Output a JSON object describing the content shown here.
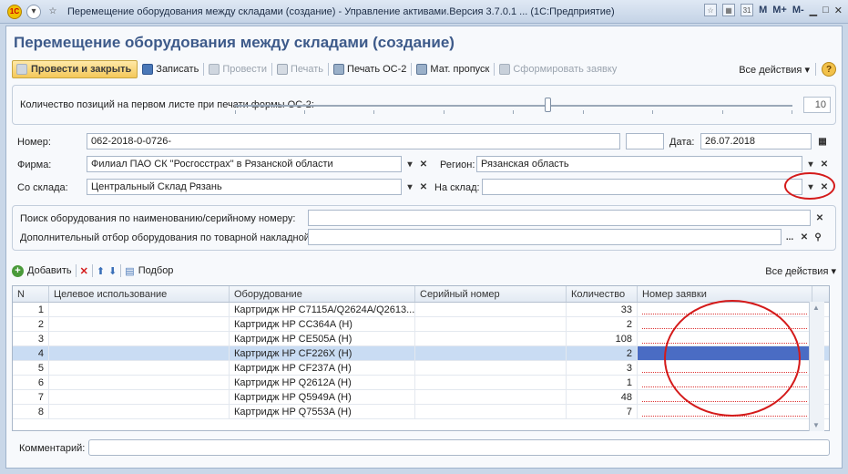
{
  "window": {
    "title": "Перемещение оборудования между складами (создание) - Управление активами.Версия 3.7.0.1 ... (1С:Предприятие)",
    "logo": "1С",
    "titlebar_right": [
      "M",
      "M+",
      "M-"
    ]
  },
  "document": {
    "title": "Перемещение оборудования между складами (создание)"
  },
  "toolbar": {
    "post_close": "Провести и закрыть",
    "save": "Записать",
    "post": "Провести",
    "print": "Печать",
    "print_os2": "Печать ОС-2",
    "pass": "Мат. пропуск",
    "make_request": "Сформировать заявку",
    "all_actions": "Все действия",
    "help": "?"
  },
  "slider": {
    "label": "Количество позиций на первом листе при печати формы ОС-2:",
    "value": "10",
    "position_fraction": 0.56
  },
  "form": {
    "number_label": "Номер:",
    "number_value": "062-2018-0-0726-",
    "date_label": "Дата:",
    "date_value": "26.07.2018",
    "firm_label": "Фирма:",
    "firm_value": "Филиал ПАО СК \"Росгосстрах\" в Рязанской области",
    "region_label": "Регион:",
    "region_value": "Рязанская область",
    "from_label": "Со склада:",
    "from_value": "Центральный Склад Рязань",
    "to_label": "На склад:",
    "to_value": ""
  },
  "search": {
    "by_name_label": "Поиск оборудования по наименованию/серийному номеру:",
    "by_name_value": "",
    "by_invoice_label": "Дополнительный отбор оборудования по товарной накладной:",
    "by_invoice_value": "",
    "ellipsis": "..."
  },
  "grid_toolbar": {
    "add": "Добавить",
    "pick": "Подбор",
    "all_actions": "Все действия"
  },
  "grid": {
    "headers": [
      "N",
      "Целевое использование",
      "Оборудование",
      "Серийный номер",
      "Количество",
      "Номер заявки"
    ],
    "rows": [
      {
        "n": "1",
        "purpose": "",
        "equipment": "Картридж HP C7115A/Q2624A/Q2613...",
        "serial": "",
        "qty": "33",
        "request": ""
      },
      {
        "n": "2",
        "purpose": "",
        "equipment": "Картридж HP CC364A (H)",
        "serial": "",
        "qty": "2",
        "request": ""
      },
      {
        "n": "3",
        "purpose": "",
        "equipment": "Картридж HP CE505A (H)",
        "serial": "",
        "qty": "108",
        "request": ""
      },
      {
        "n": "4",
        "purpose": "",
        "equipment": "Картридж HP CF226X (H)",
        "serial": "",
        "qty": "2",
        "request": ""
      },
      {
        "n": "5",
        "purpose": "",
        "equipment": "Картридж HP CF237A (H)",
        "serial": "",
        "qty": "3",
        "request": ""
      },
      {
        "n": "6",
        "purpose": "",
        "equipment": "Картридж HP Q2612A (H)",
        "serial": "",
        "qty": "1",
        "request": ""
      },
      {
        "n": "7",
        "purpose": "",
        "equipment": "Картридж HP Q5949A (H)",
        "serial": "",
        "qty": "48",
        "request": ""
      },
      {
        "n": "8",
        "purpose": "",
        "equipment": "Картридж HP Q7553A (H)",
        "serial": "",
        "qty": "7",
        "request": ""
      }
    ]
  },
  "comment": {
    "label": "Комментарий:",
    "value": ""
  },
  "colors": {
    "accent": "#3d5a8a",
    "annotation": "#d41a1a",
    "selected_row": "#c9dcf3",
    "selected_cell": "#4a6cc4"
  }
}
